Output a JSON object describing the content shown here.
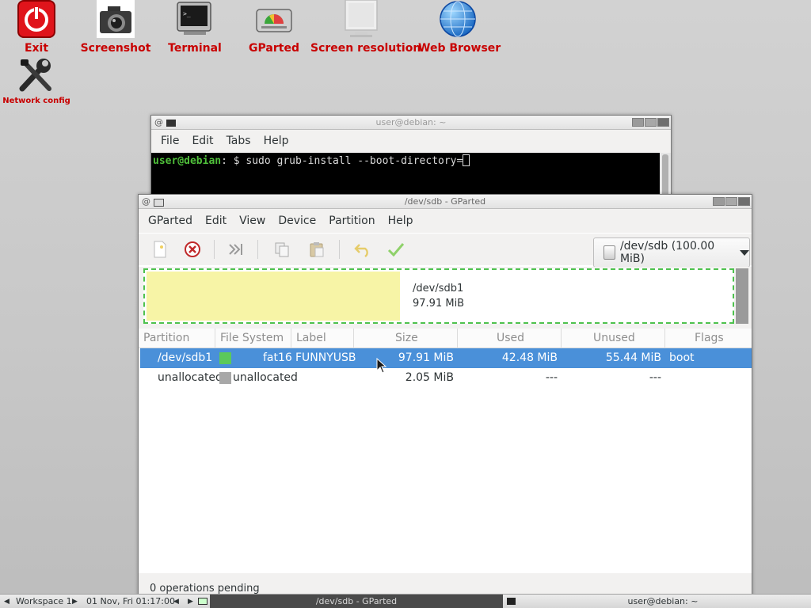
{
  "desktop": {
    "icons": {
      "exit": "Exit",
      "screenshot": "Screenshot",
      "terminal": "Terminal",
      "gparted": "GParted",
      "screen_resolution": "Screen resolution",
      "web_browser": "Web Browser",
      "network_config": "Network config"
    },
    "label_color": "#c80000"
  },
  "terminal": {
    "title": "user@debian: ~",
    "menu": [
      "File",
      "Edit",
      "Tabs",
      "Help"
    ],
    "prompt_user": "user@debian",
    "prompt_rest": ": $ sudo grub-install --boot-directory="
  },
  "gparted": {
    "title": "/dev/sdb - GParted",
    "menu": [
      "GParted",
      "Edit",
      "View",
      "Device",
      "Partition",
      "Help"
    ],
    "device_selector": "/dev/sdb (100.00 MiB)",
    "disk_graph": {
      "name": "/dev/sdb1",
      "size": "97.91 MiB"
    },
    "columns": [
      "Partition",
      "File System",
      "Label",
      "Size",
      "Used",
      "Unused",
      "Flags"
    ],
    "rows": [
      {
        "partition": "/dev/sdb1",
        "filesystem": "fat16",
        "label": "FUNNYUSB",
        "size": "97.91 MiB",
        "used": "42.48 MiB",
        "unused": "55.44 MiB",
        "flags": "boot",
        "color": "#5bc95b"
      },
      {
        "partition": "unallocated",
        "filesystem": "unallocated",
        "label": "",
        "size": "2.05 MiB",
        "used": "---",
        "unused": "---",
        "flags": "",
        "color": "#a8a8a8"
      }
    ],
    "status": "0 operations pending",
    "selected_color": "#4a90d9"
  },
  "taskbar": {
    "workspace": "Workspace 1",
    "clock": "01 Nov, Fri 01:17:00",
    "task_gparted": "/dev/sdb - GParted",
    "task_terminal": "user@debian: ~"
  }
}
